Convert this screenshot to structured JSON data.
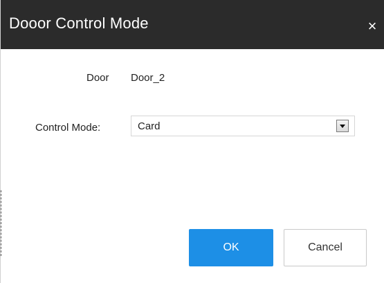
{
  "dialog": {
    "title": "Dooor Control Mode",
    "close_glyph": "×",
    "close_icon": "close-icon"
  },
  "form": {
    "door_label": "Door",
    "door_value": "Door_2",
    "mode_label": "Control Mode:",
    "mode_selected": "Card",
    "dropdown_icon": "chevron-down-icon"
  },
  "buttons": {
    "ok_label": "OK",
    "cancel_label": "Cancel"
  },
  "colors": {
    "titlebar": "#2b2b2b",
    "primary": "#1d8fe6",
    "text": "#222222"
  }
}
